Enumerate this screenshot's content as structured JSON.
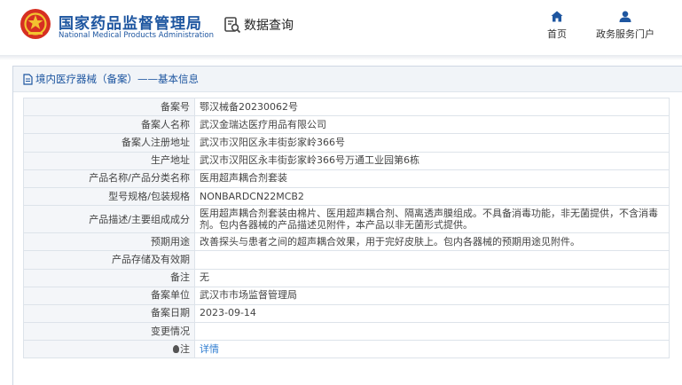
{
  "header": {
    "brand_cn": "国家药品监督管理局",
    "brand_en": "National Medical Products Administration",
    "query_label": "数据查询",
    "nav_home": "首页",
    "nav_service": "政务服务门户",
    "accent_color": "#1e56a0"
  },
  "panel": {
    "title": "境内医疗器械（备案）——基本信息"
  },
  "record": {
    "rows": [
      {
        "label": "备案号",
        "value": "鄂汉械备20230062号"
      },
      {
        "label": "备案人名称",
        "value": "武汉金瑞达医疗用品有限公司"
      },
      {
        "label": "备案人注册地址",
        "value": "武汉市汉阳区永丰街彭家岭366号"
      },
      {
        "label": "生产地址",
        "value": "武汉市汉阳区永丰街彭家岭366号万通工业园第6栋"
      },
      {
        "label": "产品名称/产品分类名称",
        "value": "医用超声耦合剂套装"
      },
      {
        "label": "型号规格/包装规格",
        "value": "NONBARDCN22MCB2"
      },
      {
        "label": "产品描述/主要组成成分",
        "value": "医用超声耦合剂套装由棉片、医用超声耦合剂、隔离透声膜组成。不具备消毒功能，非无菌提供，不含消毒剂。包内各器械的产品描述见附件，本产品以非无菌形式提供。"
      },
      {
        "label": "预期用途",
        "value": "改善探头与患者之间的超声耦合效果，用于完好皮肤上。包内各器械的预期用途见附件。"
      },
      {
        "label": "产品存储及有效期",
        "value": ""
      },
      {
        "label": "备注",
        "value": "无"
      },
      {
        "label": "备案单位",
        "value": "武汉市市场监督管理局"
      },
      {
        "label": "备案日期",
        "value": "2023-09-14"
      },
      {
        "label": "变更情况",
        "value": ""
      }
    ],
    "note_label": "注",
    "note_link": "详情"
  }
}
